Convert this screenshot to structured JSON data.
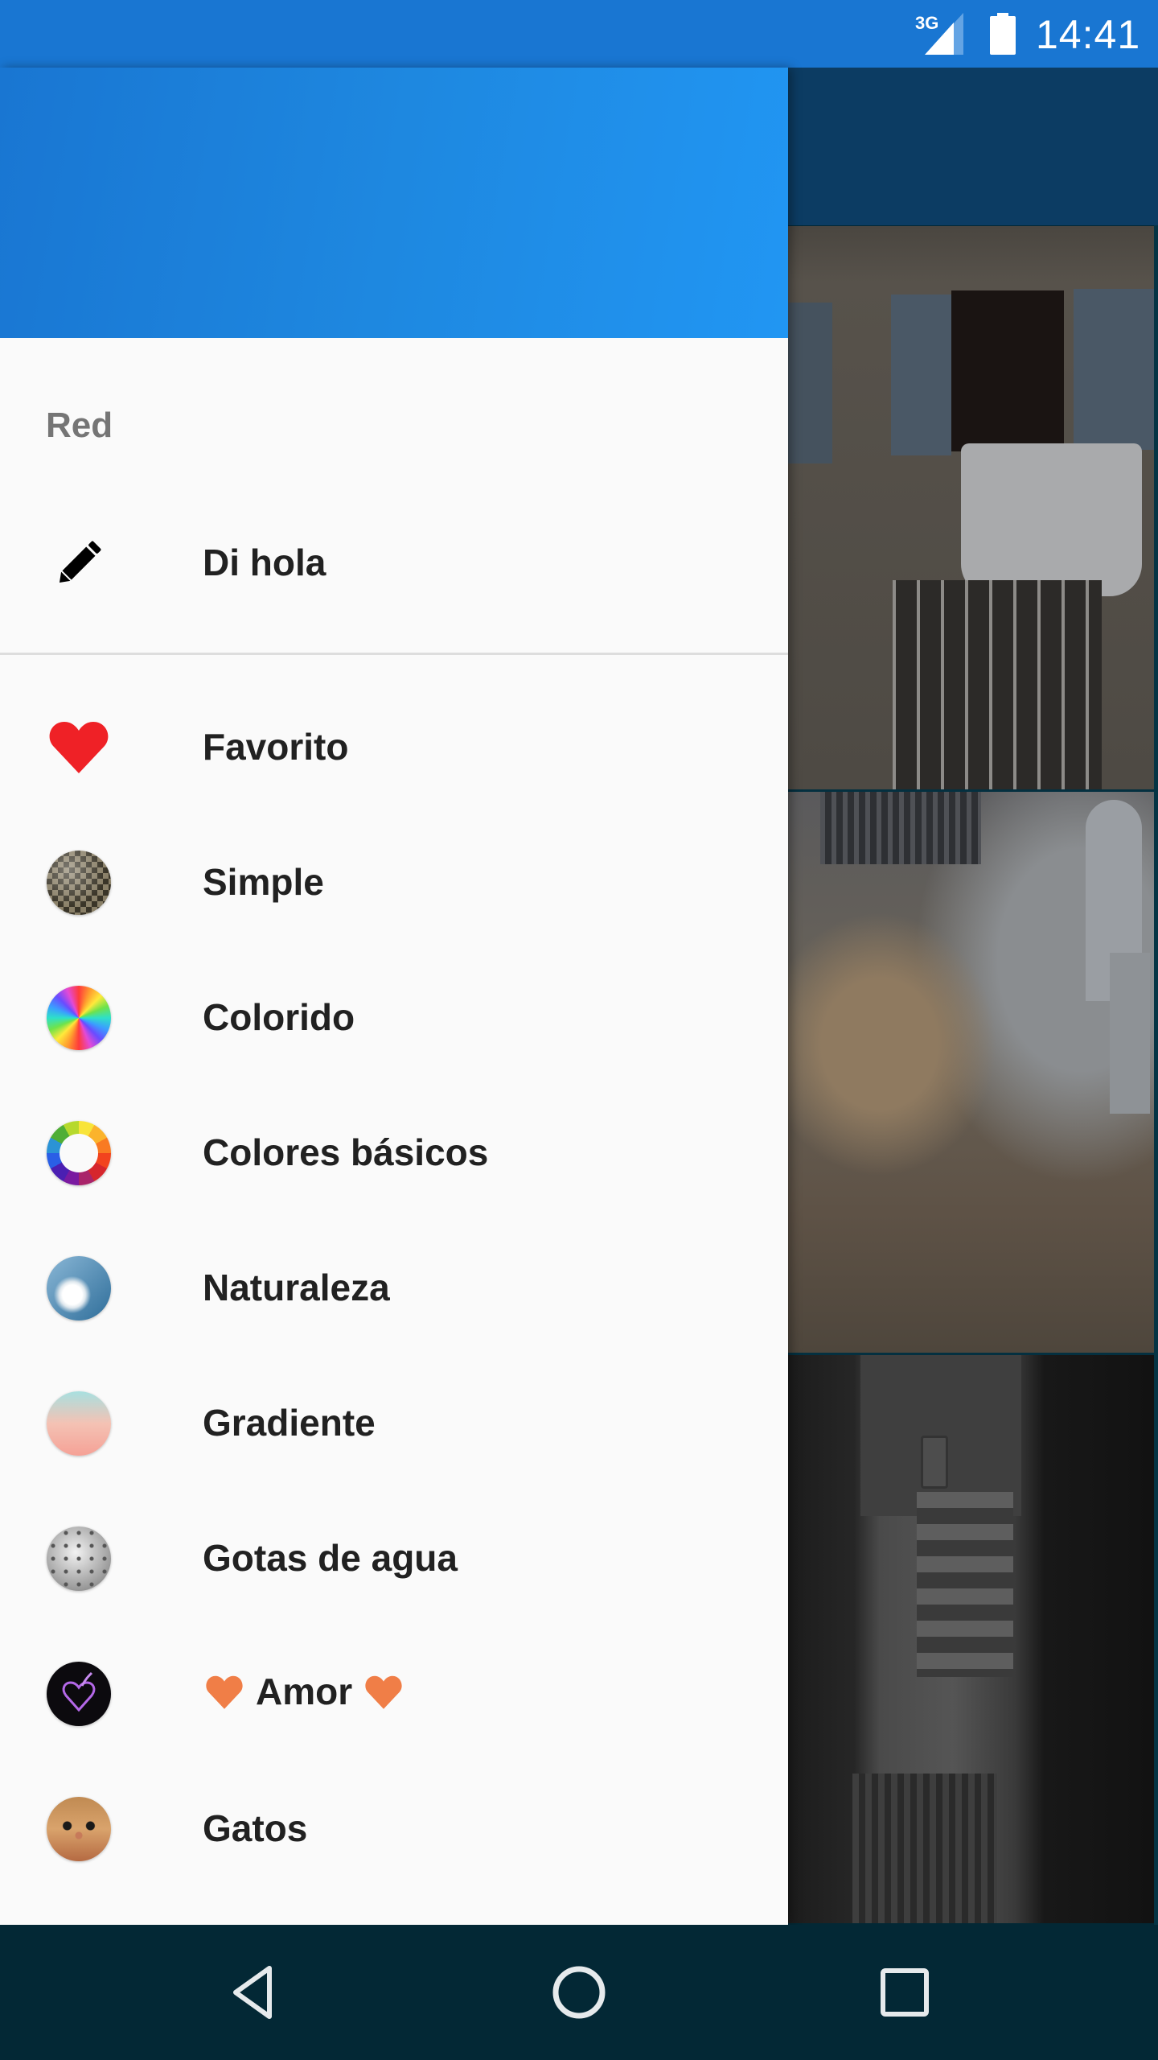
{
  "status_bar": {
    "network_type": "3G",
    "time": "14:41",
    "signal_icon": "cellular-signal-icon",
    "battery_icon": "battery-full-icon"
  },
  "drawer": {
    "section_label": "Red",
    "primary_item": {
      "label": "Di hola",
      "icon": "pencil-icon"
    },
    "items": [
      {
        "label": "Favorito",
        "icon": "heart-icon"
      },
      {
        "label": "Simple",
        "icon": "texture-ball-icon"
      },
      {
        "label": "Colorido",
        "icon": "rainbow-swirl-icon"
      },
      {
        "label": "Colores básicos",
        "icon": "color-wheel-icon"
      },
      {
        "label": "Naturaleza",
        "icon": "dandelion-icon"
      },
      {
        "label": "Gradiente",
        "icon": "gradient-ball-icon"
      },
      {
        "label": "Gotas de agua",
        "icon": "water-drops-icon"
      },
      {
        "label": "Amor",
        "icon": "purple-heart-icon",
        "prefix_emoji": "heart-emoji",
        "suffix_emoji": "heart-emoji"
      },
      {
        "label": "Gatos",
        "icon": "cat-icon"
      }
    ],
    "colors": {
      "header_start": "#1976D2",
      "header_end": "#2196F3",
      "favorite_heart": "#EF2126",
      "amor_heart": "#F07E47"
    }
  },
  "background": {
    "photos": [
      {
        "subject": "building facade with shutters and hanging quilt"
      },
      {
        "subject": "baroque church organ interior"
      },
      {
        "subject": "black and white cobblestone street with lantern"
      }
    ]
  },
  "nav_bar": {
    "back_icon": "back-triangle-icon",
    "home_icon": "home-circle-icon",
    "recents_icon": "recents-square-icon"
  }
}
